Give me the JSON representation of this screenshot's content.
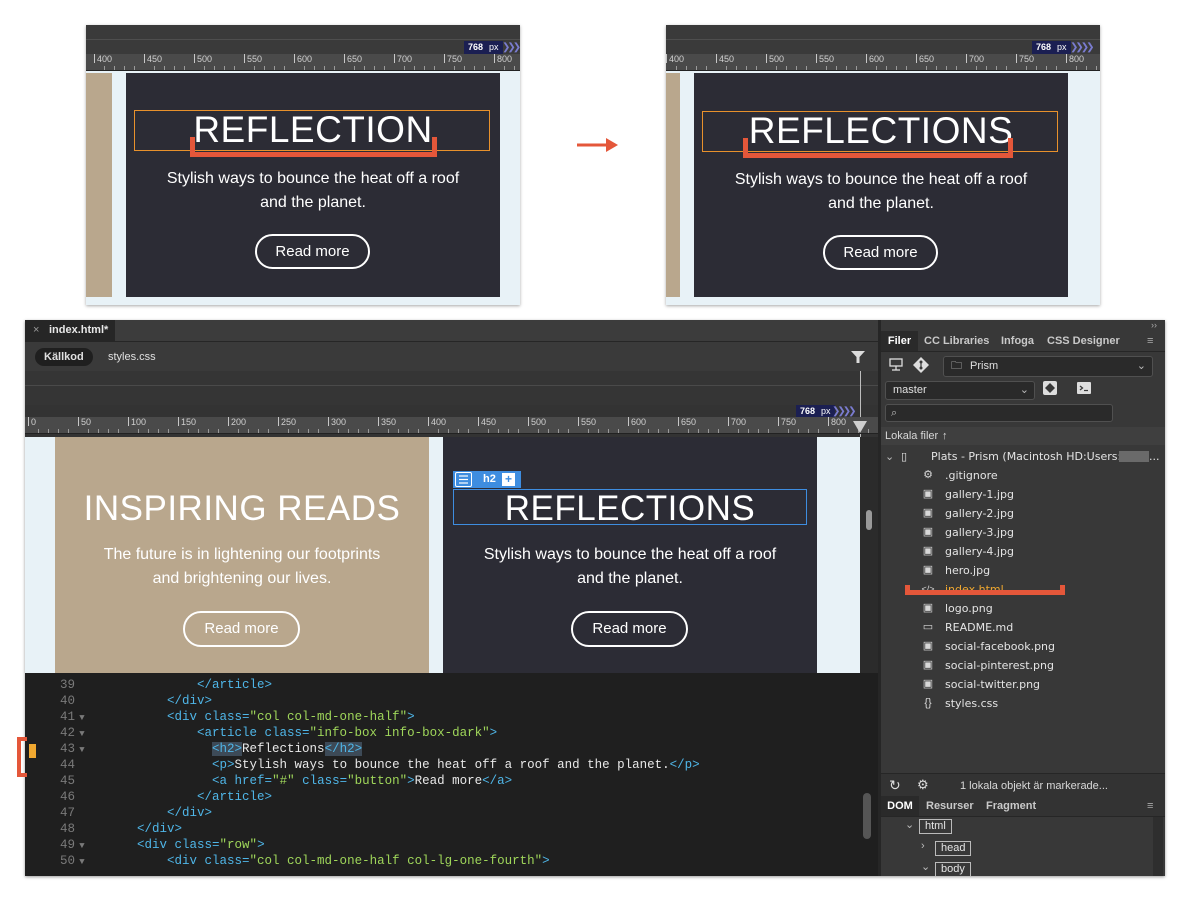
{
  "preview_before": {
    "ruler_ticks": [
      "400",
      "450",
      "500",
      "550",
      "600",
      "650",
      "700",
      "750",
      "800"
    ],
    "viewport_value": "768",
    "viewport_unit": "px",
    "heading": "REFLECTION",
    "text": "Stylish ways to bounce the heat off a roof and the planet.",
    "button": "Read more"
  },
  "arrow": "→",
  "preview_after": {
    "ruler_ticks": [
      "400",
      "450",
      "500",
      "550",
      "600",
      "650",
      "700",
      "750",
      "800"
    ],
    "viewport_value": "768",
    "viewport_unit": "px",
    "heading": "REFLECTIONS",
    "text": "Stylish ways to bounce the heat off a roof and the planet.",
    "button": "Read more"
  },
  "doc": {
    "tab_title": "index.html*",
    "source_tabs": [
      "Källkod",
      "styles.css"
    ]
  },
  "design_view": {
    "viewport_value": "768",
    "viewport_unit": "px",
    "ruler_ticks": [
      "0",
      "50",
      "100",
      "150",
      "200",
      "250",
      "300",
      "350",
      "400",
      "450",
      "500",
      "550",
      "600",
      "650",
      "700",
      "750",
      "800"
    ],
    "left_card": {
      "heading": "INSPIRING READS",
      "text": "The future is in lightening our footprints and brightening our lives.",
      "button": "Read more"
    },
    "right_card": {
      "element_tag": "h2",
      "add_symbol": "+",
      "heading": "REFLECTIONS",
      "text": "Stylish ways to bounce the heat off a roof and the planet.",
      "button": "Read more"
    }
  },
  "code_lines": [
    {
      "n": "39",
      "fold": "",
      "parts": [
        [
          "",
          "            "
        ],
        [
          "tag",
          "</article>"
        ]
      ]
    },
    {
      "n": "40",
      "fold": "",
      "parts": [
        [
          "",
          "        "
        ],
        [
          "tag",
          "</div>"
        ]
      ]
    },
    {
      "n": "41",
      "fold": "▼",
      "parts": [
        [
          "",
          "        "
        ],
        [
          "tag",
          "<div "
        ],
        [
          "attr",
          "class="
        ],
        [
          "str",
          "\"col col-md-one-half\""
        ],
        [
          "tag",
          ">"
        ]
      ]
    },
    {
      "n": "42",
      "fold": "▼",
      "parts": [
        [
          "",
          "            "
        ],
        [
          "tag",
          "<article "
        ],
        [
          "attr",
          "class="
        ],
        [
          "str",
          "\"info-box info-box-dark\""
        ],
        [
          "tag",
          ">"
        ]
      ]
    },
    {
      "n": "43",
      "fold": "▼",
      "parts": [
        [
          "",
          "              "
        ],
        [
          "tag",
          "<h2>"
        ],
        [
          "txt",
          "Reflections"
        ],
        [
          "tag",
          "</h2>"
        ]
      ]
    },
    {
      "n": "44",
      "fold": "",
      "parts": [
        [
          "",
          "              "
        ],
        [
          "tag",
          "<p>"
        ],
        [
          "txt",
          "Stylish ways to bounce the heat off a roof and the planet."
        ],
        [
          "tag",
          "</p>"
        ]
      ]
    },
    {
      "n": "45",
      "fold": "",
      "parts": [
        [
          "",
          "              "
        ],
        [
          "tag",
          "<a "
        ],
        [
          "attr",
          "href="
        ],
        [
          "str",
          "\"#\""
        ],
        [
          "attr",
          " class="
        ],
        [
          "str",
          "\"button\""
        ],
        [
          "tag",
          ">"
        ],
        [
          "txt",
          "Read more"
        ],
        [
          "tag",
          "</a>"
        ]
      ]
    },
    {
      "n": "46",
      "fold": "",
      "parts": [
        [
          "",
          "            "
        ],
        [
          "tag",
          "</article>"
        ]
      ]
    },
    {
      "n": "47",
      "fold": "",
      "parts": [
        [
          "",
          "        "
        ],
        [
          "tag",
          "</div>"
        ]
      ]
    },
    {
      "n": "48",
      "fold": "",
      "parts": [
        [
          "",
          "    "
        ],
        [
          "tag",
          "</div>"
        ]
      ]
    },
    {
      "n": "49",
      "fold": "▼",
      "parts": [
        [
          "",
          "    "
        ],
        [
          "tag",
          "<div "
        ],
        [
          "attr",
          "class="
        ],
        [
          "str",
          "\"row\""
        ],
        [
          "tag",
          ">"
        ]
      ]
    },
    {
      "n": "50",
      "fold": "▼",
      "parts": [
        [
          "",
          "        "
        ],
        [
          "tag",
          "<div "
        ],
        [
          "attr",
          "class="
        ],
        [
          "str",
          "\"col col-md-one-half col-lg-one-fourth\""
        ],
        [
          "tag",
          ">"
        ]
      ]
    }
  ],
  "files_panel": {
    "tabs": [
      "Filer",
      "CC Libraries",
      "Infoga",
      "CSS Designer"
    ],
    "site": "Prism",
    "branch": "master",
    "local_files_label": "Lokala filer",
    "root": "Plats - Prism (Macintosh HD:Users:",
    "root_ellipsis": "...",
    "files": [
      {
        "name": ".gitignore",
        "icon": "gear-file-icon"
      },
      {
        "name": "gallery-1.jpg",
        "icon": "image-file-icon"
      },
      {
        "name": "gallery-2.jpg",
        "icon": "image-file-icon"
      },
      {
        "name": "gallery-3.jpg",
        "icon": "image-file-icon"
      },
      {
        "name": "gallery-4.jpg",
        "icon": "image-file-icon"
      },
      {
        "name": "hero.jpg",
        "icon": "image-file-icon"
      },
      {
        "name": "index.html",
        "icon": "code-file-icon",
        "highlight": true
      },
      {
        "name": "logo.png",
        "icon": "image-file-icon"
      },
      {
        "name": "README.md",
        "icon": "doc-file-icon"
      },
      {
        "name": "social-facebook.png",
        "icon": "image-file-icon"
      },
      {
        "name": "social-pinterest.png",
        "icon": "image-file-icon"
      },
      {
        "name": "social-twitter.png",
        "icon": "image-file-icon"
      },
      {
        "name": "styles.css",
        "icon": "braces-file-icon"
      }
    ],
    "status": "1 lokala objekt är markerade..."
  },
  "dom_panel": {
    "tabs": [
      "DOM",
      "Resurser",
      "Fragment"
    ],
    "nodes": [
      "html",
      "head",
      "body"
    ]
  },
  "colors": {
    "accent_orange": "#e4573a",
    "highlight_file": "#f0a830",
    "selection_blue": "#3e8de0"
  }
}
